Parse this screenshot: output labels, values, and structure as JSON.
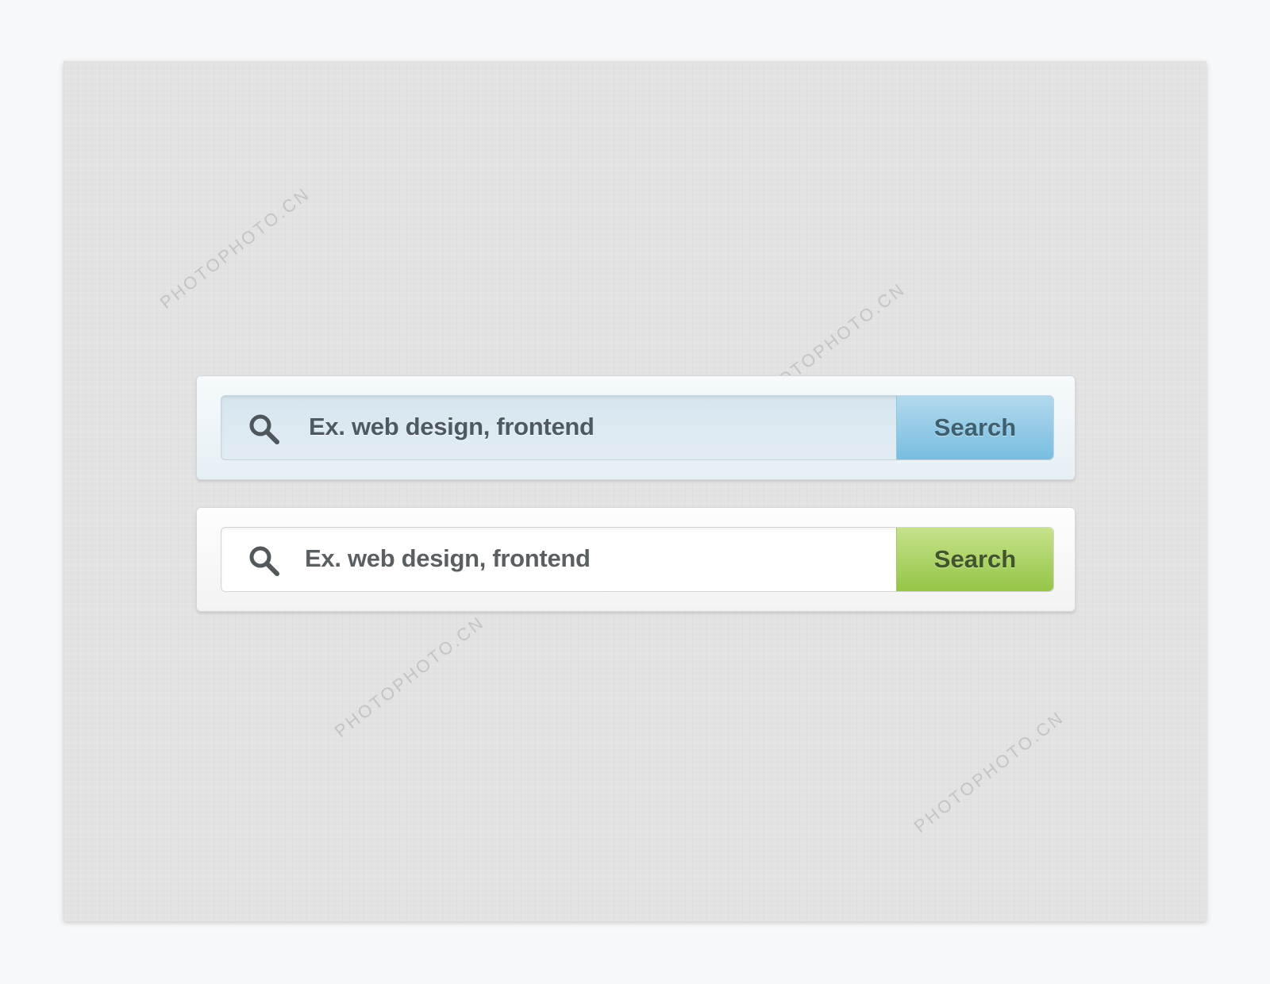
{
  "watermark": "PHOTOPHOTO.CN",
  "search_bars": [
    {
      "variant": "blue",
      "placeholder": "Ex. web design, frontend",
      "button_label": "Search",
      "accent": "#78bde0",
      "icon": "search-icon"
    },
    {
      "variant": "green",
      "placeholder": "Ex. web design, frontend",
      "button_label": "Search",
      "accent": "#94c547",
      "icon": "search-icon"
    }
  ]
}
